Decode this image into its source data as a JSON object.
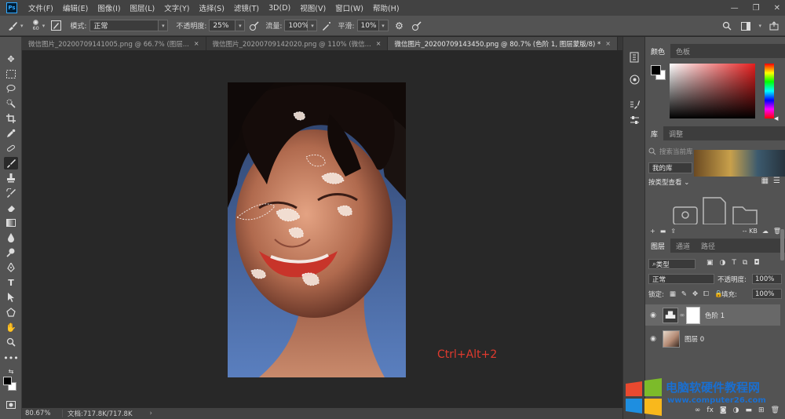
{
  "app": {
    "logo": "Ps"
  },
  "menu": [
    "文件(F)",
    "编辑(E)",
    "图像(I)",
    "图层(L)",
    "文字(Y)",
    "选择(S)",
    "滤镜(T)",
    "3D(D)",
    "视图(V)",
    "窗口(W)",
    "帮助(H)"
  ],
  "window_controls": {
    "minimize": "—",
    "restore": "❐",
    "close": "✕"
  },
  "options": {
    "brush_size": "60",
    "mode_label": "模式:",
    "mode_value": "正常",
    "opacity_label": "不透明度:",
    "opacity_value": "25%",
    "flow_label": "流量:",
    "flow_value": "100%",
    "smooth_label": "平滑:",
    "smooth_value": "10%"
  },
  "tabs": [
    {
      "label": "微信图片_20200709141005.png @ 66.7% (图层...",
      "close": "×"
    },
    {
      "label": "微信图片_20200709142020.png @ 110% (微信...",
      "close": "×"
    },
    {
      "label": "微信图片_20200709143450.png @ 80.7% (色阶 1, 图层蒙版/8) *",
      "close": "×"
    }
  ],
  "annotation": "Ctrl+Alt+2",
  "status": {
    "zoom": "80.67%",
    "doc": "文档:717.8K/717.8K",
    "caret": "›"
  },
  "color_panel": {
    "tabs": [
      "颜色",
      "色板"
    ]
  },
  "library_panel": {
    "tabs": [
      "库",
      "调整"
    ],
    "search_placeholder": "搜索当前库",
    "library_name": "我的库",
    "view_label": "按类型查看",
    "size_label": "-- KB"
  },
  "layers_panel": {
    "tabs": [
      "图层",
      "通道",
      "路径"
    ],
    "filter_label": "类型",
    "blend_mode": "正常",
    "opacity_label": "不透明度:",
    "opacity_value": "100%",
    "lock_label": "锁定:",
    "fill_label": "填充:",
    "fill_value": "100%",
    "layers": [
      {
        "name": "色阶 1",
        "selected": true
      },
      {
        "name": "图层 0",
        "selected": false
      }
    ],
    "footer_link": "fx"
  },
  "watermark": {
    "title": "电脑软硬件教程网",
    "url": "www.computer26.com"
  },
  "colors": {
    "accent_red": "#e03a2e",
    "watermark_blue": "#1a6fd0"
  }
}
